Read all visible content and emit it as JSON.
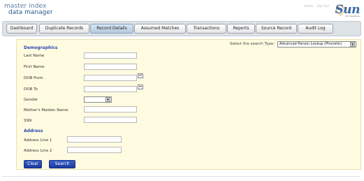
{
  "branding": {
    "line1": "master index",
    "line2": "data manager",
    "vendor": "Sun",
    "vendor_sub": "microsystems"
  },
  "user": {
    "name": "wndmi",
    "signout": "Sign Out"
  },
  "tabs": [
    {
      "label": "Dashboard"
    },
    {
      "label": "Duplicate Records"
    },
    {
      "label": "Record Details"
    },
    {
      "label": "Assumed Matches"
    },
    {
      "label": "Transactions"
    },
    {
      "label": "Reports"
    },
    {
      "label": "Source Record"
    },
    {
      "label": "Audit Log"
    }
  ],
  "active_tab": "Record Details",
  "search": {
    "type_label": "Select the search Type:",
    "type_value": "Advanced Person Lookup (Phonetic)"
  },
  "demographics": {
    "title": "Demographics",
    "last_name": {
      "label": "Last Name",
      "value": ""
    },
    "first_name": {
      "label": "First Name",
      "value": ""
    },
    "dob_from": {
      "label": "DOB From",
      "value": ""
    },
    "dob_to": {
      "label": "DOB To",
      "value": ""
    },
    "gender": {
      "label": "Gender",
      "value": ""
    },
    "maiden": {
      "label": "Mother's Maiden Name",
      "value": ""
    },
    "ssn": {
      "label": "SSN",
      "value": ""
    }
  },
  "address": {
    "title": "Address",
    "line1": {
      "label": "Address Line 1",
      "value": ""
    },
    "line2": {
      "label": "Address Line 2",
      "value": ""
    }
  },
  "buttons": {
    "clear": "Clear",
    "search": "Search"
  }
}
